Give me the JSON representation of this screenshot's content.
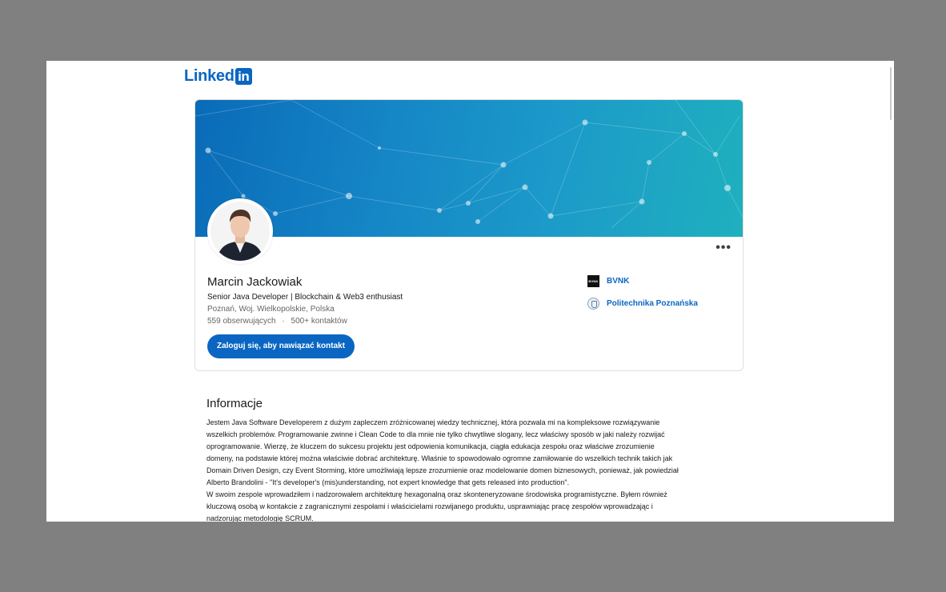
{
  "brand": {
    "name_text": "Linked",
    "name_box": "in",
    "accent": "#0a66c2"
  },
  "profile": {
    "name": "Marcin Jackowiak",
    "headline": "Senior Java Developer | Blockchain & Web3 enthusiast",
    "location": "Poznań, Woj. Wielkopolskie, Polska",
    "followers": "559 obserwujących",
    "separator": "·",
    "connections": "500+ kontaktów",
    "connect_label": "Zaloguj się, aby nawiązać kontakt",
    "more_label": "•••"
  },
  "organizations": [
    {
      "name": "BVNK",
      "logo_text": "BVNK",
      "icon": "bvnk-logo-icon"
    },
    {
      "name": "Politechnika Poznańska",
      "icon": "university-crest-icon"
    }
  ],
  "about": {
    "title": "Informacje",
    "text": "Jestem Java Software Developerem z dużym zapleczem zróżnicowanej wiedzy technicznej, która pozwala mi na kompleksowe rozwiązywanie\nwszelkich problemów. Programowanie zwinne i Clean Code to dla mnie nie tylko chwytliwe slogany, lecz właściwy sposób w jaki należy rozwijać\noprogramowanie. Wierzę, że kluczem do sukcesu projektu jest odpowienia komunikacja, ciągła edukacja zespołu oraz właściwe zrozumienie\ndomeny, na podstawie której można właściwie dobrać architekturę. Właśnie to spowodowało ogromne zamiłowanie do wszelkich technik takich jak\nDomain Driven Design, czy Event Storming, które umożliwiają lepsze zrozumienie oraz modelowanie domen biznesowych, ponieważ, jak powiedział\nAlberto Brandolini - \"It's developer's (mis)understanding, not expert knowledge that gets released into production\".\nW swoim zespole wprowadziłem i nadzorowałem architekturę hexagonalną oraz skonteneryzowane środowiska programistyczne. Byłem również\nkluczową osobą w kontakcie z zagranicznymi zespołami i właścicielami rozwijanego produktu, usprawniając pracę zespołów wprowadzając i\nnadzorując metodologię SCRUM."
  }
}
